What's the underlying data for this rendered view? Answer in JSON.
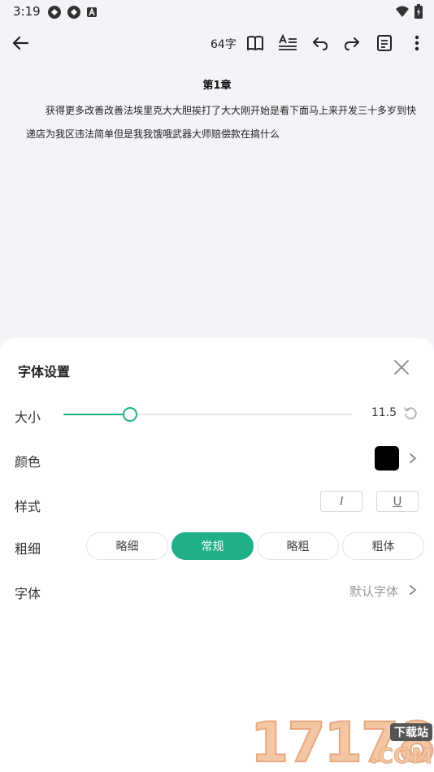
{
  "status_bar": {
    "time": "3:19",
    "left_icons": [
      "app-icon",
      "app-icon",
      "a-icon"
    ],
    "right_icons": [
      "wifi-icon",
      "battery-icon"
    ]
  },
  "toolbar": {
    "word_count": "64字",
    "icons": [
      "back-arrow-icon",
      "book-icon",
      "text-format-icon",
      "undo-icon",
      "redo-icon",
      "document-icon",
      "more-vert-icon"
    ]
  },
  "document": {
    "chapter_title": "第1章",
    "body": "获得更多改善改善法埃里克大大胆挨打了大大刚开始是看下面马上来开发三十多岁到快递店为我区违法简单但是我我饿哦武器大师赔偿款在搞什么"
  },
  "font_settings": {
    "title": "字体设置",
    "size": {
      "label": "大小",
      "value": "11.5",
      "slider_fraction": 0.23
    },
    "color": {
      "label": "颜色",
      "value": "#000000"
    },
    "style": {
      "label": "样式",
      "italic_label": "I",
      "underline_label": "U"
    },
    "weight": {
      "label": "粗细",
      "options": [
        "略细",
        "常规",
        "略粗",
        "粗体"
      ],
      "selected": "常规"
    },
    "font": {
      "label": "字体",
      "value": "默认字体"
    }
  },
  "watermark": {
    "digits": "17178",
    "badge": "下载站",
    "suffix": ".COM"
  },
  "colors": {
    "accent": "#1fb087",
    "background": "#f4f4f8",
    "sheet": "#ffffff"
  }
}
